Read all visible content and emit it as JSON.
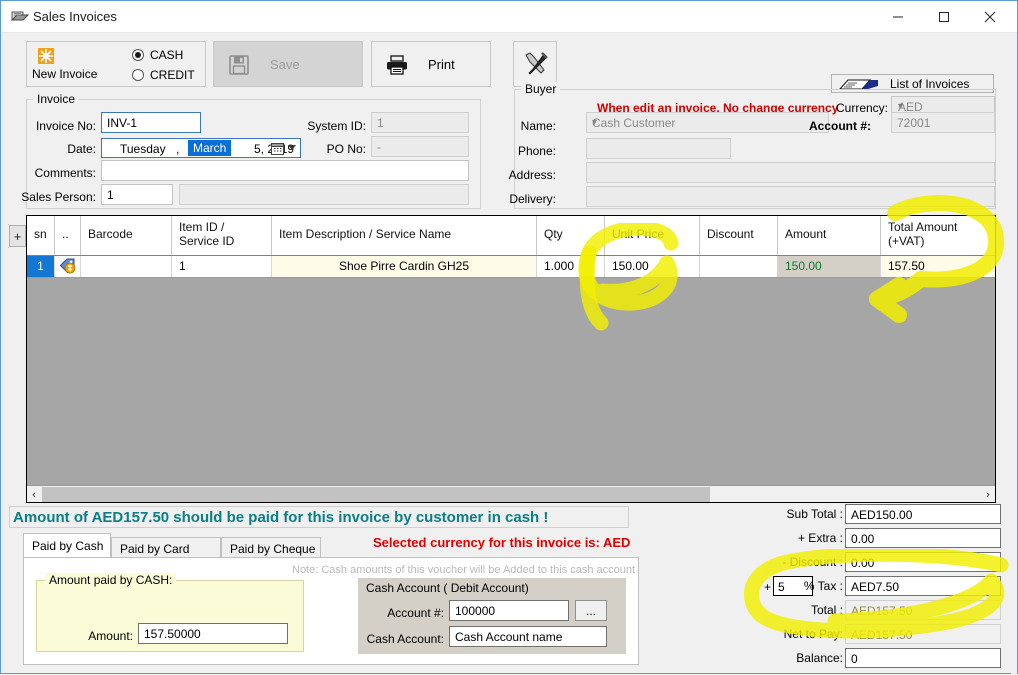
{
  "window": {
    "title": "Sales Invoices",
    "icon": "invoice-window-icon",
    "minimize": "–",
    "maximize": "□",
    "close": "✕"
  },
  "toolbar": {
    "new_invoice_label": "New Invoice",
    "new_invoice_icon": "new-document-icon",
    "cash_label": "CASH",
    "cash_selected": true,
    "credit_label": "CREDIT",
    "credit_selected": false,
    "save_label": "Save",
    "save_icon": "floppy-disk-icon",
    "save_enabled": false,
    "print_label": "Print",
    "print_icon": "printer-icon",
    "tools_icon": "hammer-screwdriver-icon",
    "list_of_invoices_label": "List of Invoices",
    "list_of_invoices_icon": "stacked-papers-icon",
    "warning_text": "When edit an invoice, No change currency",
    "currency_label": "Currency:",
    "currency_value": "AED"
  },
  "invoice": {
    "legend": "Invoice",
    "invoice_no_label": "Invoice No:",
    "invoice_no_value": "INV-1",
    "system_id_label": "System ID:",
    "system_id_value": "1",
    "date_label": "Date:",
    "date_day": "Tuesday",
    "date_comma": ",",
    "date_month": "March",
    "date_rest": "5, 2019",
    "po_no_label": "PO No:",
    "po_no_value": "-",
    "comments_label": "Comments:",
    "comments_value": "",
    "sales_person_label": "Sales Person:",
    "sales_person_value": "1",
    "sales_person_name": ""
  },
  "buyer": {
    "legend": "Buyer",
    "name_label": "Name:",
    "name_value": "Cash Customer",
    "account_label": "Account #:",
    "account_value": "72001",
    "phone_label": "Phone:",
    "phone_value": "",
    "address_label": "Address:",
    "address_value": "",
    "delivery_label": "Delivery:",
    "delivery_value": ""
  },
  "grid": {
    "add_row_label": "+",
    "columns": [
      {
        "key": "sn",
        "label": "sn"
      },
      {
        "key": "dots",
        "label": ".."
      },
      {
        "key": "barcode",
        "label": "Barcode"
      },
      {
        "key": "item_id",
        "label": "Item ID /",
        "label2": "Service ID"
      },
      {
        "key": "description",
        "label": "Item Description  / Service Name"
      },
      {
        "key": "qty",
        "label": "Qty"
      },
      {
        "key": "unit_price",
        "label": "Unit Price"
      },
      {
        "key": "discount",
        "label": "Discount"
      },
      {
        "key": "amount",
        "label": "Amount"
      },
      {
        "key": "total_amount",
        "label": "Total Amount",
        "label2": "(+VAT)"
      }
    ],
    "rows": [
      {
        "sn": "1",
        "dots_icon": "price-tag-icon",
        "barcode": "",
        "item_id": "1",
        "description": "Shoe Pirre Cardin GH25",
        "qty": "1.000",
        "unit_price": "150.00",
        "discount": "",
        "amount": "150.00",
        "total_amount": "157.50"
      }
    ],
    "scroll_left": "‹",
    "scroll_right": "›"
  },
  "payment": {
    "banner": "Amount of AED157.50 should be paid for this invoice by customer in cash !",
    "selected_currency_note": "Selected currency for this invoice is: AED",
    "tabs": [
      {
        "label": "Paid by Cash",
        "active": true
      },
      {
        "label": "Paid by Card (POS)",
        "active": false
      },
      {
        "label": "Paid by Cheque",
        "active": false
      }
    ],
    "note": "Note: Cash amounts of this voucher will be Added to  this cash account",
    "cash_group_legend": "Amount paid by CASH:",
    "amount_label": "Amount:",
    "amount_value": "157.50000",
    "debit_legend": "Cash Account ( Debit Account)",
    "account_no_label": "Account #:",
    "account_no_value": "100000",
    "browse_label": "...",
    "cash_account_label": "Cash Account:",
    "cash_account_value": "Cash Account name"
  },
  "totals": {
    "sub_total_label": "Sub Total :",
    "sub_total_value": "AED150.00",
    "extra_label": "+ Extra :",
    "extra_value": "0.00",
    "discount_label": "- Discount :",
    "discount_value": "0.00",
    "tax_plus": "+",
    "tax_rate_value": "5",
    "tax_label": "% Tax :",
    "tax_value": "AED7.50",
    "total_label": "Total :",
    "total_value": "AED157.50",
    "net_to_pay_label": "Net to Pay:",
    "net_to_pay_value": "AED157.50",
    "balance_label": "Balance:",
    "balance_value": "0"
  },
  "colors": {
    "highlighter": "#f2ee00",
    "warning_red": "#d00000",
    "banner_teal": "#0a7f86",
    "selection_blue": "#1278d4",
    "row_cream": "#fffbe9"
  }
}
